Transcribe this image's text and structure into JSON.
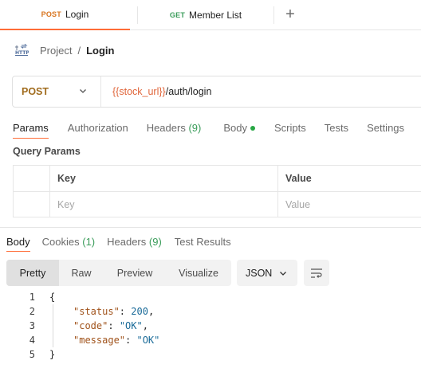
{
  "tabs": [
    {
      "method": "POST",
      "label": "Login"
    },
    {
      "method": "GET",
      "label": "Member List"
    }
  ],
  "tab_add_label": "+",
  "breadcrumb": {
    "project": "Project",
    "separator": "/",
    "current": "Login"
  },
  "request": {
    "method": "POST",
    "url_variable": "{{stock_url}}",
    "url_path": "/auth/login"
  },
  "request_tabs": [
    {
      "label": "Params",
      "count": ""
    },
    {
      "label": "Authorization",
      "count": ""
    },
    {
      "label": "Headers",
      "count": "(9)"
    },
    {
      "label": "Body",
      "count": ""
    },
    {
      "label": "Scripts",
      "count": ""
    },
    {
      "label": "Tests",
      "count": ""
    },
    {
      "label": "Settings",
      "count": ""
    }
  ],
  "query_params": {
    "title": "Query Params",
    "headers": {
      "key": "Key",
      "value": "Value"
    },
    "placeholders": {
      "key": "Key",
      "value": "Value"
    }
  },
  "response_tabs": [
    {
      "label": "Body",
      "count": ""
    },
    {
      "label": "Cookies",
      "count": "(1)"
    },
    {
      "label": "Headers",
      "count": "(9)"
    },
    {
      "label": "Test Results",
      "count": ""
    }
  ],
  "view_modes": [
    "Pretty",
    "Raw",
    "Preview",
    "Visualize"
  ],
  "format": "JSON",
  "code": {
    "line_numbers": [
      "1",
      "2",
      "3",
      "4",
      "5"
    ],
    "open_brace": "{",
    "close_brace": "}",
    "entries": [
      {
        "key": "\"status\"",
        "value": "200",
        "trail": ","
      },
      {
        "key": "\"code\"",
        "value": "\"OK\"",
        "trail": ","
      },
      {
        "key": "\"message\"",
        "value": "\"OK\"",
        "trail": ""
      }
    ]
  },
  "colors": {
    "accent": "#ff6c37",
    "post": "#d8741e",
    "get": "#3a9c5a",
    "variable": "#e0653a",
    "status_dot": "#28a745"
  }
}
